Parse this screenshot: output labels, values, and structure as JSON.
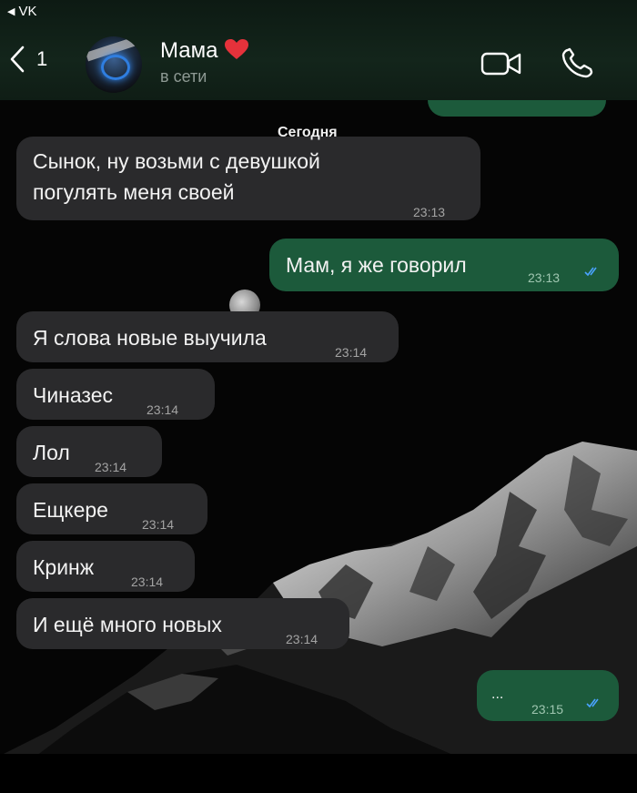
{
  "status_bar": {
    "back_app": "VK"
  },
  "header": {
    "back_count": "1",
    "contact_name": "Мама",
    "contact_status": "в сети"
  },
  "date_label": "Сегодня",
  "messages": [
    {
      "direction": "in",
      "text_line1": "Сынок, ну возьми с девушкой",
      "text_line2": "погулять меня своей",
      "time": "23:13"
    },
    {
      "direction": "out",
      "text": "Мам, я же говорил",
      "time": "23:13"
    },
    {
      "direction": "in",
      "text": "Я слова новые выучила",
      "time": "23:14"
    },
    {
      "direction": "in",
      "text": "Чиназес",
      "time": "23:14"
    },
    {
      "direction": "in",
      "text": "Лол",
      "time": "23:14"
    },
    {
      "direction": "in",
      "text": "Ещкере",
      "time": "23:14"
    },
    {
      "direction": "in",
      "text": "Кринж",
      "time": "23:14"
    },
    {
      "direction": "in",
      "text": "И ещё много новых",
      "time": "23:14"
    },
    {
      "direction": "out",
      "text": "...",
      "time": "23:15"
    }
  ],
  "colors": {
    "incoming_bubble": "#2a2a2c",
    "outgoing_bubble": "#1c5a3b",
    "read_check": "#4aa3ff",
    "heart": "#e5323b"
  }
}
